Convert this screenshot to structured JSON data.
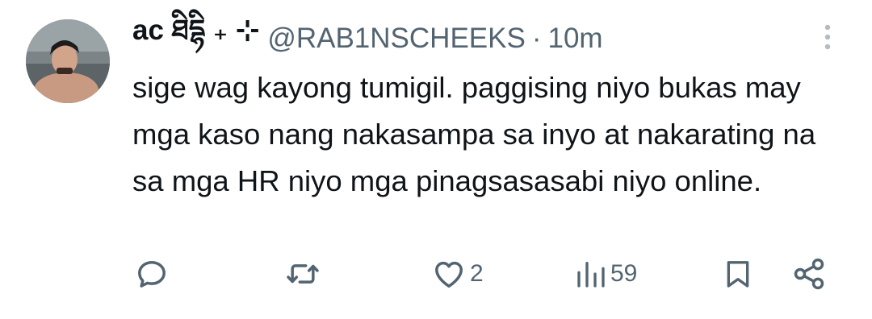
{
  "tweet": {
    "display_name": "ac ཐིདྷི ₊ ⊹",
    "handle": "@RAB1NSCHEEKS",
    "separator": "·",
    "time": "10m",
    "text": "sige wag kayong tumigil. paggising niyo bukas may mga kaso nang nakasampa sa inyo at nakarating na sa mga HR niyo mga pinagsasasabi niyo online."
  },
  "actions": {
    "reply_icon": "reply-icon",
    "retweet_icon": "retweet-icon",
    "like_icon": "heart-icon",
    "like_count": "2",
    "views_icon": "views-icon",
    "views_count": "59",
    "bookmark_icon": "bookmark-icon",
    "share_icon": "share-icon"
  },
  "colors": {
    "text": "#0f1419",
    "secondary": "#536471",
    "background": "#ffffff"
  }
}
